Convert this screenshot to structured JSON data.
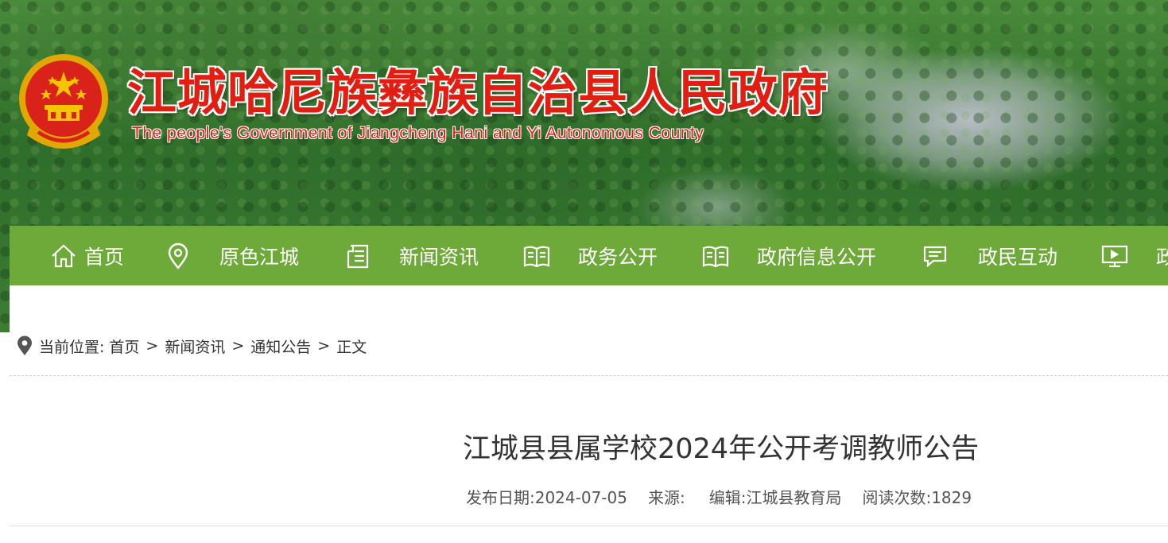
{
  "header": {
    "title": "江城哈尼族彝族自治县人民政府",
    "subtitle": "The people's Government of Jiangcheng Hani and Yi Autonomous County",
    "emblem_icon": "national-emblem-icon",
    "title_color": "#e21d12"
  },
  "nav": {
    "background": "#6eaa3a",
    "items": [
      {
        "label": "首页",
        "icon": "home-icon"
      },
      {
        "label": "原色江城",
        "icon": "location-pin-icon"
      },
      {
        "label": "新闻资讯",
        "icon": "news-icon"
      },
      {
        "label": "政务公开",
        "icon": "open-book-icon"
      },
      {
        "label": "政府信息公开",
        "icon": "open-book-icon"
      },
      {
        "label": "政民互动",
        "icon": "chat-icon"
      },
      {
        "label": "政",
        "icon": "monitor-icon"
      }
    ]
  },
  "breadcrumb": {
    "prefix": "当前位置:",
    "items": [
      "首页",
      "新闻资讯",
      "通知公告",
      "正文"
    ],
    "separator": ">"
  },
  "article": {
    "title": "江城县县属学校2024年公开考调教师公告",
    "publish_date": "发布日期:2024-07-05",
    "source": "来源:",
    "editor": "编辑:江城县教育局",
    "views": "阅读次数:1829"
  }
}
